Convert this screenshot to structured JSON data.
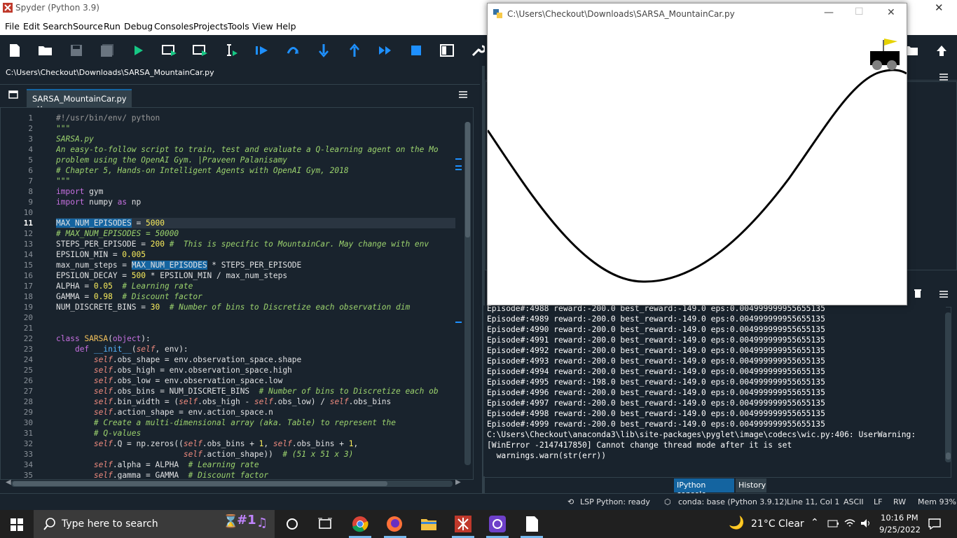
{
  "window": {
    "title": "Spyder (Python 3.9)"
  },
  "menu": [
    "File",
    "Edit",
    "Search",
    "Source",
    "Run",
    "Debug",
    "Consoles",
    "Projects",
    "Tools",
    "View",
    "Help"
  ],
  "toolbar": {
    "icons": [
      "new-file-icon",
      "open-file-icon",
      "save-icon",
      "save-all-icon",
      "run-icon",
      "run-cell-icon",
      "run-cell-advance-icon",
      "run-selection-icon",
      "debug-icon",
      "step-over-icon",
      "step-into-icon",
      "step-return-icon",
      "continue-icon",
      "stop-icon",
      "maximize-pane-icon",
      "preferences-icon"
    ]
  },
  "editor": {
    "path": "C:\\Users\\Checkout\\Downloads\\SARSA_MountainCar.py",
    "tab_label": "SARSA_MountainCar.py",
    "tab_close": "✕",
    "current_line": 11
  },
  "code_lines": [
    "#!/usr/bin/env/ python",
    "\"\"\"",
    "SARSA.py",
    "An easy-to-follow script to train, test and evaluate a Q-learning agent on the Mo",
    "problem using the OpenAI Gym. |Praveen Palanisamy",
    "# Chapter 5, Hands-on Intelligent Agents with OpenAI Gym, 2018",
    "\"\"\"",
    "import gym",
    "import numpy as np",
    "",
    "MAX_NUM_EPISODES = 5000",
    "# MAX_NUM_EPISODES = 50000",
    "STEPS_PER_EPISODE = 200 #  This is specific to MountainCar. May change with env",
    "EPSILON_MIN = 0.005",
    "max_num_steps = MAX_NUM_EPISODES * STEPS_PER_EPISODE",
    "EPSILON_DECAY = 500 * EPSILON_MIN / max_num_steps",
    "ALPHA = 0.05  # Learning rate",
    "GAMMA = 0.98  # Discount factor",
    "NUM_DISCRETE_BINS = 30  # Number of bins to Discretize each observation dim",
    "",
    "",
    "class SARSA(object):",
    "    def __init__(self, env):",
    "        self.obs_shape = env.observation_space.shape",
    "        self.obs_high = env.observation_space.high",
    "        self.obs_low = env.observation_space.low",
    "        self.obs_bins = NUM_DISCRETE_BINS  # Number of bins to Discretize each ob",
    "        self.bin_width = (self.obs_high - self.obs_low) / self.obs_bins",
    "        self.action_shape = env.action_space.n",
    "        # Create a multi-dimensional array (aka. Table) to represent the",
    "        # Q-values",
    "        self.Q = np.zeros((self.obs_bins + 1, self.obs_bins + 1,",
    "                           self.action_shape))  # (51 x 51 x 3)",
    "        self.alpha = ALPHA  # Learning rate",
    "        self.gamma = GAMMA  # Discount factor"
  ],
  "pyglet": {
    "title": "C:\\Users\\Checkout\\Downloads\\SARSA_MountainCar.py",
    "controls": [
      "—",
      "☐",
      "✕"
    ]
  },
  "console_lines": [
    "Episode#:4988 reward:-200.0 best_reward:-149.0 eps:0.004999999955655135",
    "Episode#:4989 reward:-200.0 best_reward:-149.0 eps:0.004999999955655135",
    "Episode#:4990 reward:-200.0 best_reward:-149.0 eps:0.004999999955655135",
    "Episode#:4991 reward:-200.0 best_reward:-149.0 eps:0.004999999955655135",
    "Episode#:4992 reward:-200.0 best_reward:-149.0 eps:0.004999999955655135",
    "Episode#:4993 reward:-200.0 best_reward:-149.0 eps:0.004999999955655135",
    "Episode#:4994 reward:-200.0 best_reward:-149.0 eps:0.004999999955655135",
    "Episode#:4995 reward:-198.0 best_reward:-149.0 eps:0.004999999955655135",
    "Episode#:4996 reward:-200.0 best_reward:-149.0 eps:0.004999999955655135",
    "Episode#:4997 reward:-200.0 best_reward:-149.0 eps:0.004999999955655135",
    "Episode#:4998 reward:-200.0 best_reward:-149.0 eps:0.004999999955655135",
    "Episode#:4999 reward:-200.0 best_reward:-149.0 eps:0.004999999955655135",
    "C:\\Users\\Checkout\\anaconda3\\lib\\site-packages\\pyglet\\image\\codecs\\wic.py:406: UserWarning:",
    "[WinError -2147417850] Cannot change thread mode after it is set",
    "  warnings.warn(str(err))"
  ],
  "console_tabs": [
    "IPython console",
    "History"
  ],
  "status": {
    "lsp": "LSP Python: ready",
    "conda": "conda: base (Python 3.9.12)",
    "position": "Line 11, Col 1",
    "encoding": "ASCII",
    "eol": "LF",
    "perm": "RW",
    "mem": "Mem 93%"
  },
  "taskbar": {
    "search_placeholder": "Type here to search",
    "weather": "21°C  Clear",
    "time": "10:16 PM",
    "date": "9/25/2022",
    "icons": [
      "windows-start-icon",
      "cortana-icon",
      "task-view-icon",
      "chrome-icon",
      "firefox-icon",
      "file-explorer-icon",
      "spyder-icon",
      "github-icon",
      "notepad-icon"
    ]
  },
  "colors": {
    "accent": "#1464a0",
    "bg": "#19232d",
    "border": "#32414b"
  }
}
